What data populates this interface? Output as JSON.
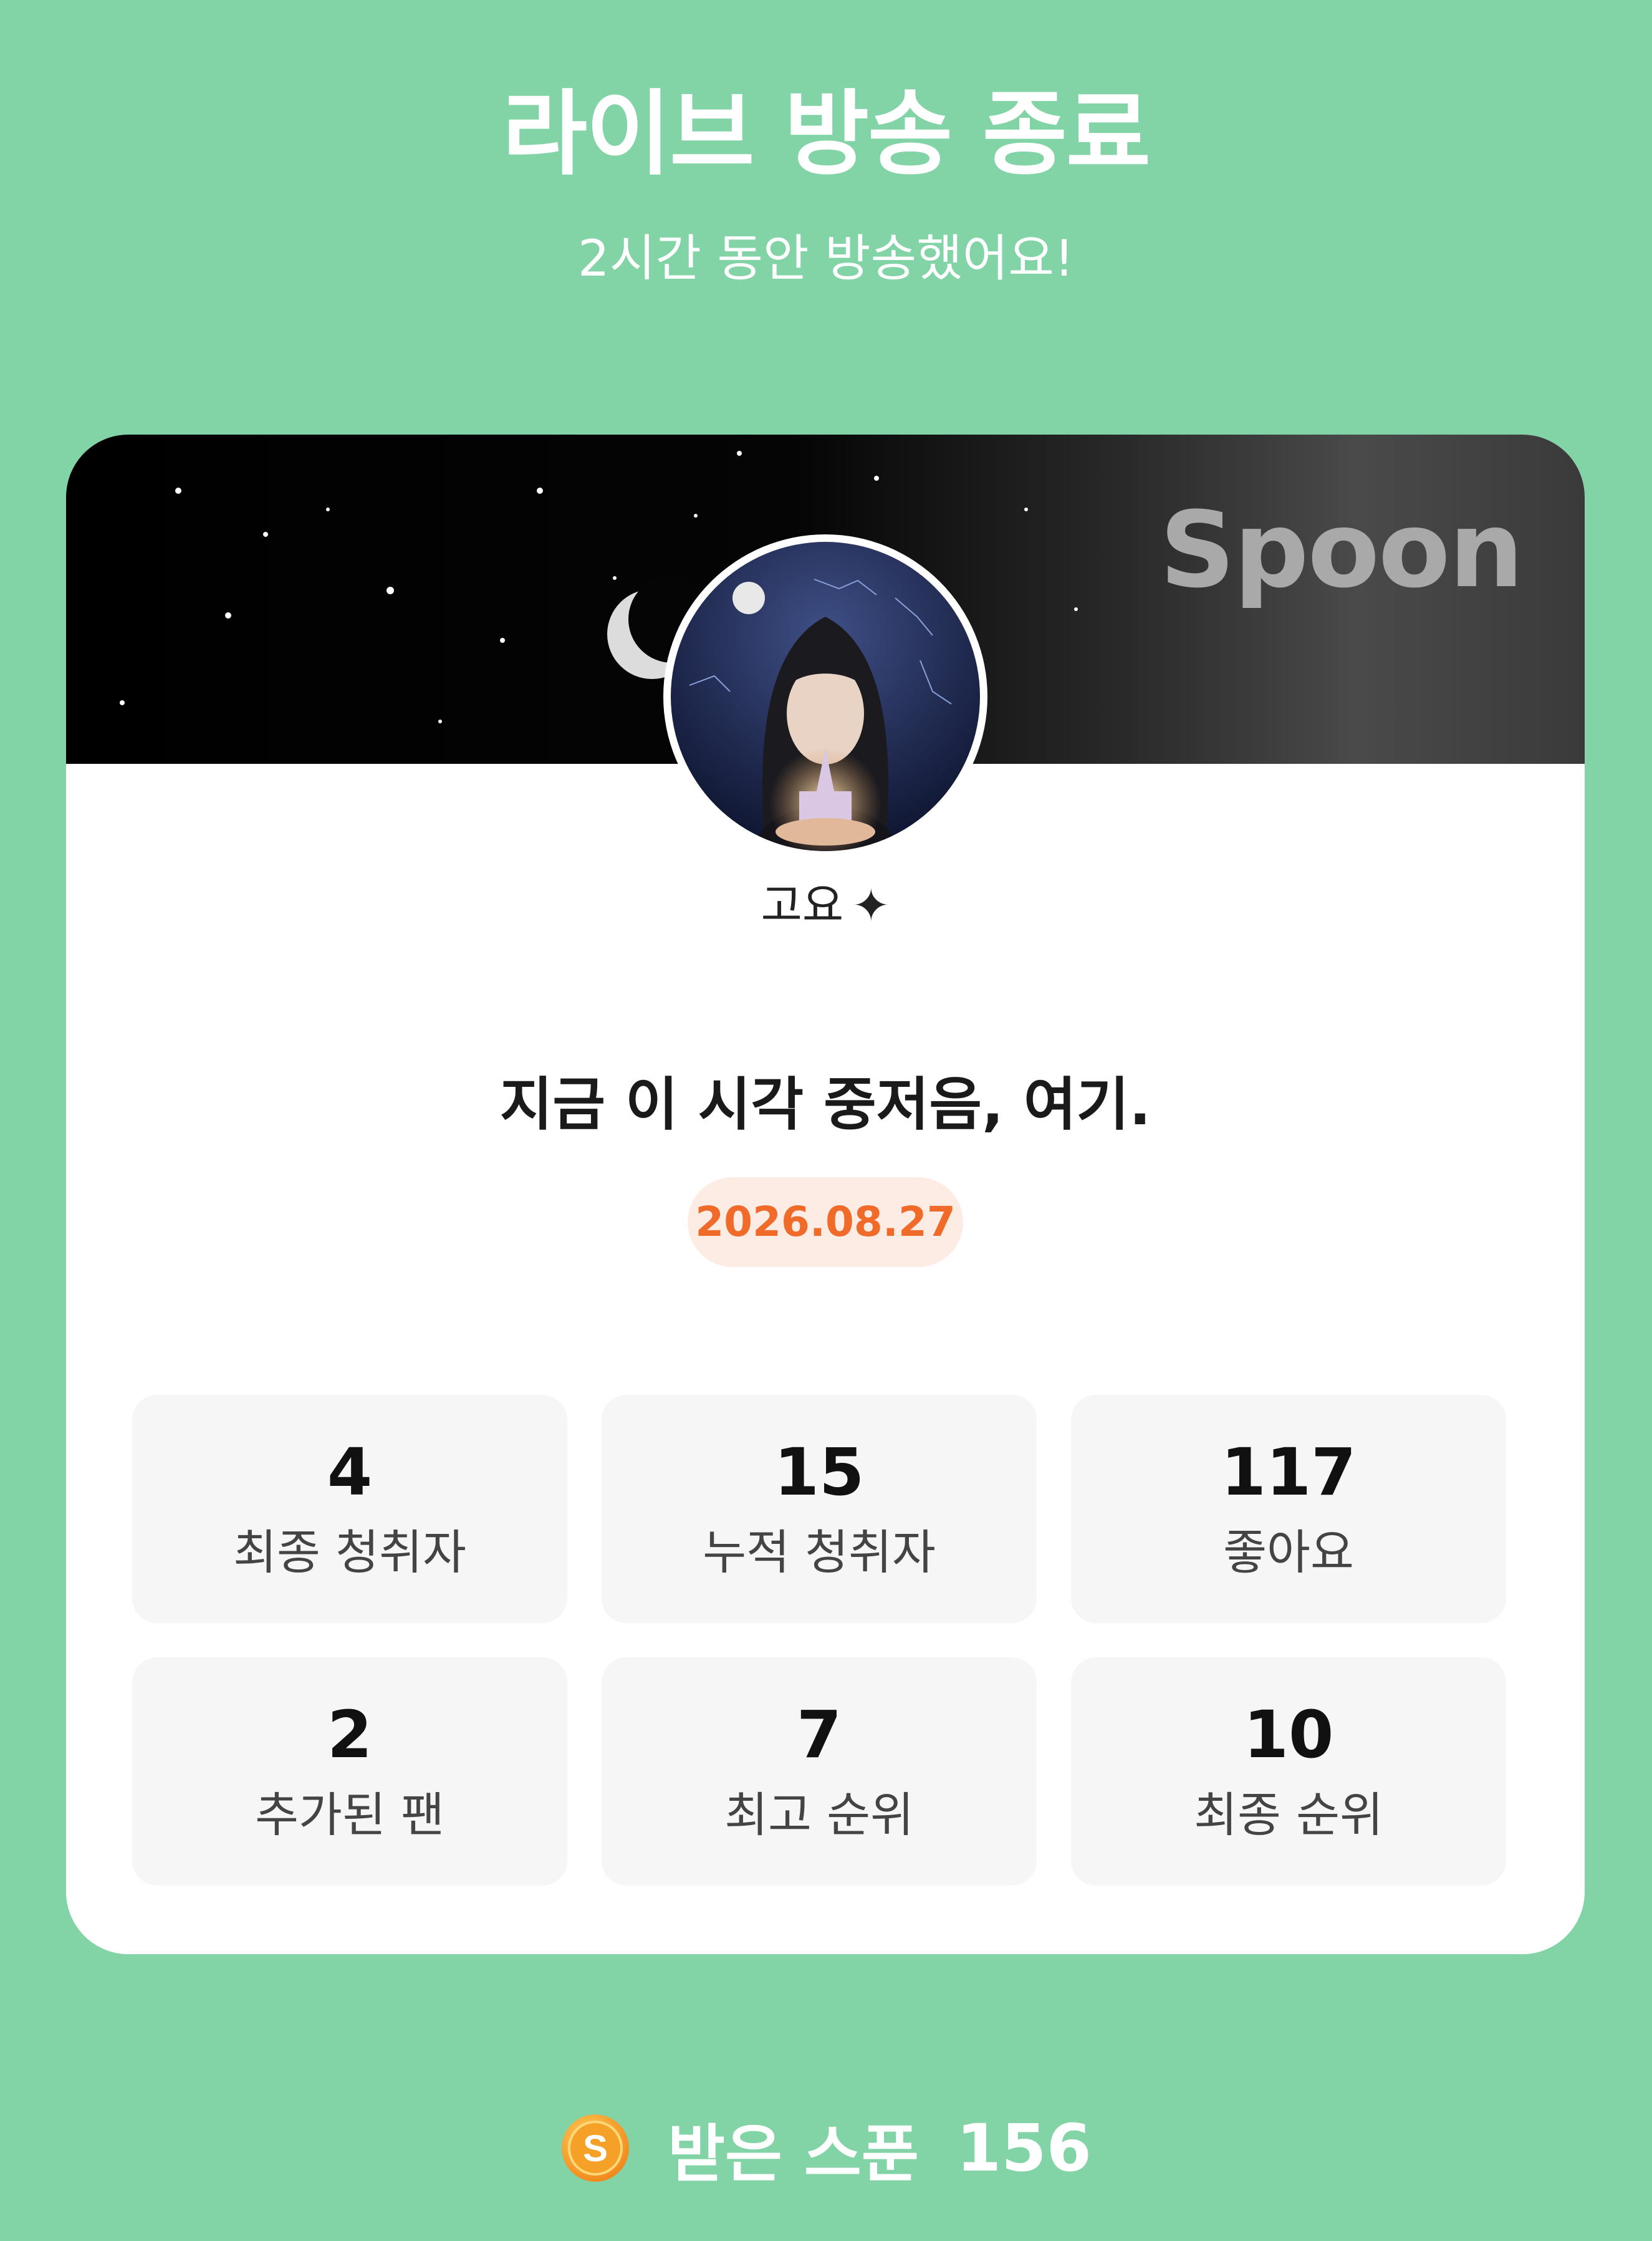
{
  "header": {
    "title": "라이브 방송 종료",
    "subtitle": "2시간 동안 방송했어요!"
  },
  "card": {
    "brand": "Spoon",
    "nickname": "고요",
    "nickname_icon": "sparkle-icon",
    "room_title": "지금 이 시각 중저음, 여기.",
    "date": "2026.08.27"
  },
  "stats": [
    {
      "value": "4",
      "label": "최종 청취자"
    },
    {
      "value": "15",
      "label": "누적 청취자"
    },
    {
      "value": "117",
      "label": "좋아요"
    },
    {
      "value": "2",
      "label": "추가된 팬"
    },
    {
      "value": "7",
      "label": "최고 순위"
    },
    {
      "value": "10",
      "label": "최종 순위"
    }
  ],
  "footer": {
    "icon": "spoon-coin-icon",
    "label": "받은 스푼",
    "count": "156"
  },
  "colors": {
    "background": "#82D4A7",
    "accent_orange": "#F06A2A",
    "badge_bg": "#FDECE4"
  }
}
